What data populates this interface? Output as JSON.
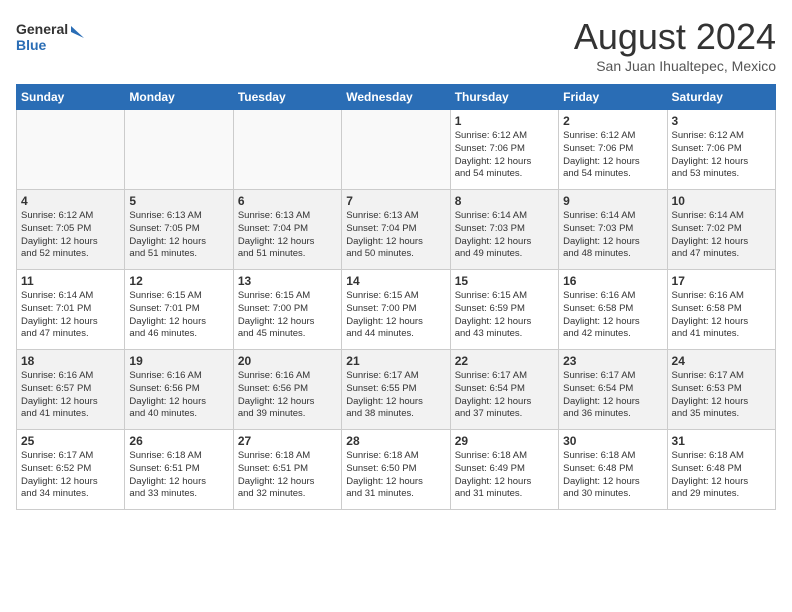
{
  "header": {
    "logo_line1": "General",
    "logo_line2": "Blue",
    "month": "August 2024",
    "location": "San Juan Ihualtepec, Mexico"
  },
  "days_of_week": [
    "Sunday",
    "Monday",
    "Tuesday",
    "Wednesday",
    "Thursday",
    "Friday",
    "Saturday"
  ],
  "weeks": [
    [
      {
        "day": "",
        "info": "",
        "empty": true
      },
      {
        "day": "",
        "info": "",
        "empty": true
      },
      {
        "day": "",
        "info": "",
        "empty": true
      },
      {
        "day": "",
        "info": "",
        "empty": true
      },
      {
        "day": "1",
        "info": "Sunrise: 6:12 AM\nSunset: 7:06 PM\nDaylight: 12 hours\nand 54 minutes."
      },
      {
        "day": "2",
        "info": "Sunrise: 6:12 AM\nSunset: 7:06 PM\nDaylight: 12 hours\nand 54 minutes."
      },
      {
        "day": "3",
        "info": "Sunrise: 6:12 AM\nSunset: 7:06 PM\nDaylight: 12 hours\nand 53 minutes."
      }
    ],
    [
      {
        "day": "4",
        "info": "Sunrise: 6:12 AM\nSunset: 7:05 PM\nDaylight: 12 hours\nand 52 minutes."
      },
      {
        "day": "5",
        "info": "Sunrise: 6:13 AM\nSunset: 7:05 PM\nDaylight: 12 hours\nand 51 minutes."
      },
      {
        "day": "6",
        "info": "Sunrise: 6:13 AM\nSunset: 7:04 PM\nDaylight: 12 hours\nand 51 minutes."
      },
      {
        "day": "7",
        "info": "Sunrise: 6:13 AM\nSunset: 7:04 PM\nDaylight: 12 hours\nand 50 minutes."
      },
      {
        "day": "8",
        "info": "Sunrise: 6:14 AM\nSunset: 7:03 PM\nDaylight: 12 hours\nand 49 minutes."
      },
      {
        "day": "9",
        "info": "Sunrise: 6:14 AM\nSunset: 7:03 PM\nDaylight: 12 hours\nand 48 minutes."
      },
      {
        "day": "10",
        "info": "Sunrise: 6:14 AM\nSunset: 7:02 PM\nDaylight: 12 hours\nand 47 minutes."
      }
    ],
    [
      {
        "day": "11",
        "info": "Sunrise: 6:14 AM\nSunset: 7:01 PM\nDaylight: 12 hours\nand 47 minutes."
      },
      {
        "day": "12",
        "info": "Sunrise: 6:15 AM\nSunset: 7:01 PM\nDaylight: 12 hours\nand 46 minutes."
      },
      {
        "day": "13",
        "info": "Sunrise: 6:15 AM\nSunset: 7:00 PM\nDaylight: 12 hours\nand 45 minutes."
      },
      {
        "day": "14",
        "info": "Sunrise: 6:15 AM\nSunset: 7:00 PM\nDaylight: 12 hours\nand 44 minutes."
      },
      {
        "day": "15",
        "info": "Sunrise: 6:15 AM\nSunset: 6:59 PM\nDaylight: 12 hours\nand 43 minutes."
      },
      {
        "day": "16",
        "info": "Sunrise: 6:16 AM\nSunset: 6:58 PM\nDaylight: 12 hours\nand 42 minutes."
      },
      {
        "day": "17",
        "info": "Sunrise: 6:16 AM\nSunset: 6:58 PM\nDaylight: 12 hours\nand 41 minutes."
      }
    ],
    [
      {
        "day": "18",
        "info": "Sunrise: 6:16 AM\nSunset: 6:57 PM\nDaylight: 12 hours\nand 41 minutes."
      },
      {
        "day": "19",
        "info": "Sunrise: 6:16 AM\nSunset: 6:56 PM\nDaylight: 12 hours\nand 40 minutes."
      },
      {
        "day": "20",
        "info": "Sunrise: 6:16 AM\nSunset: 6:56 PM\nDaylight: 12 hours\nand 39 minutes."
      },
      {
        "day": "21",
        "info": "Sunrise: 6:17 AM\nSunset: 6:55 PM\nDaylight: 12 hours\nand 38 minutes."
      },
      {
        "day": "22",
        "info": "Sunrise: 6:17 AM\nSunset: 6:54 PM\nDaylight: 12 hours\nand 37 minutes."
      },
      {
        "day": "23",
        "info": "Sunrise: 6:17 AM\nSunset: 6:54 PM\nDaylight: 12 hours\nand 36 minutes."
      },
      {
        "day": "24",
        "info": "Sunrise: 6:17 AM\nSunset: 6:53 PM\nDaylight: 12 hours\nand 35 minutes."
      }
    ],
    [
      {
        "day": "25",
        "info": "Sunrise: 6:17 AM\nSunset: 6:52 PM\nDaylight: 12 hours\nand 34 minutes."
      },
      {
        "day": "26",
        "info": "Sunrise: 6:18 AM\nSunset: 6:51 PM\nDaylight: 12 hours\nand 33 minutes."
      },
      {
        "day": "27",
        "info": "Sunrise: 6:18 AM\nSunset: 6:51 PM\nDaylight: 12 hours\nand 32 minutes."
      },
      {
        "day": "28",
        "info": "Sunrise: 6:18 AM\nSunset: 6:50 PM\nDaylight: 12 hours\nand 31 minutes."
      },
      {
        "day": "29",
        "info": "Sunrise: 6:18 AM\nSunset: 6:49 PM\nDaylight: 12 hours\nand 31 minutes."
      },
      {
        "day": "30",
        "info": "Sunrise: 6:18 AM\nSunset: 6:48 PM\nDaylight: 12 hours\nand 30 minutes."
      },
      {
        "day": "31",
        "info": "Sunrise: 6:18 AM\nSunset: 6:48 PM\nDaylight: 12 hours\nand 29 minutes."
      }
    ]
  ]
}
